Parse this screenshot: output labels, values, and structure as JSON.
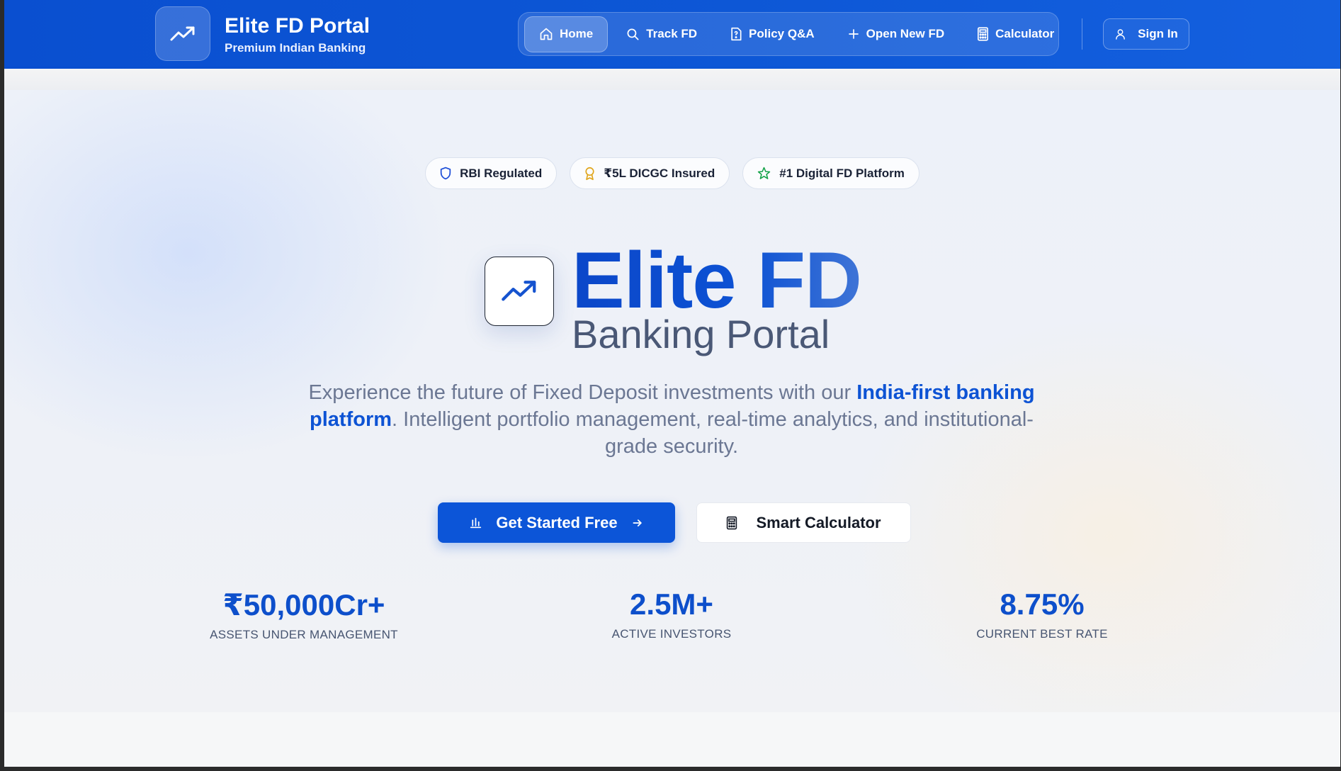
{
  "header": {
    "brand_title": "Elite FD Portal",
    "brand_subtitle": "Premium Indian Banking",
    "brand_icon": "trending-up-icon",
    "nav": [
      {
        "label": "Home",
        "icon": "home-icon",
        "active": true
      },
      {
        "label": "Track FD",
        "icon": "search-icon",
        "active": false
      },
      {
        "label": "Policy Q&A",
        "icon": "document-icon",
        "active": false
      },
      {
        "label": "Open New FD",
        "icon": "plus-icon",
        "active": false
      },
      {
        "label": "Calculator",
        "icon": "calculator-icon",
        "active": false
      }
    ],
    "signin_label": "Sign In"
  },
  "badges": [
    {
      "label": "RBI Regulated",
      "icon": "shield-icon",
      "color": "#1d4ed8"
    },
    {
      "label": "₹5L DICGC Insured",
      "icon": "award-icon",
      "color": "#e0a51b"
    },
    {
      "label": "#1 Digital FD Platform",
      "icon": "star-icon",
      "color": "#16a34a"
    }
  ],
  "hero": {
    "title": "Elite FD",
    "subtitle": "Banking Portal",
    "desc_pre": "Experience the future of Fixed Deposit investments with our ",
    "desc_highlight": "India-first banking platform",
    "desc_post": ". Intelligent portfolio management, real-time analytics, and institutional-grade security.",
    "primary_cta": "Get Started Free",
    "secondary_cta": "Smart Calculator"
  },
  "stats": [
    {
      "value": "₹50,000Cr+",
      "label": "ASSETS UNDER MANAGEMENT"
    },
    {
      "value": "2.5M+",
      "label": "ACTIVE INVESTORS"
    },
    {
      "value": "8.75%",
      "label": "CURRENT BEST RATE"
    }
  ],
  "colors": {
    "primary": "#0c55d8",
    "header": "#0d57d6"
  }
}
